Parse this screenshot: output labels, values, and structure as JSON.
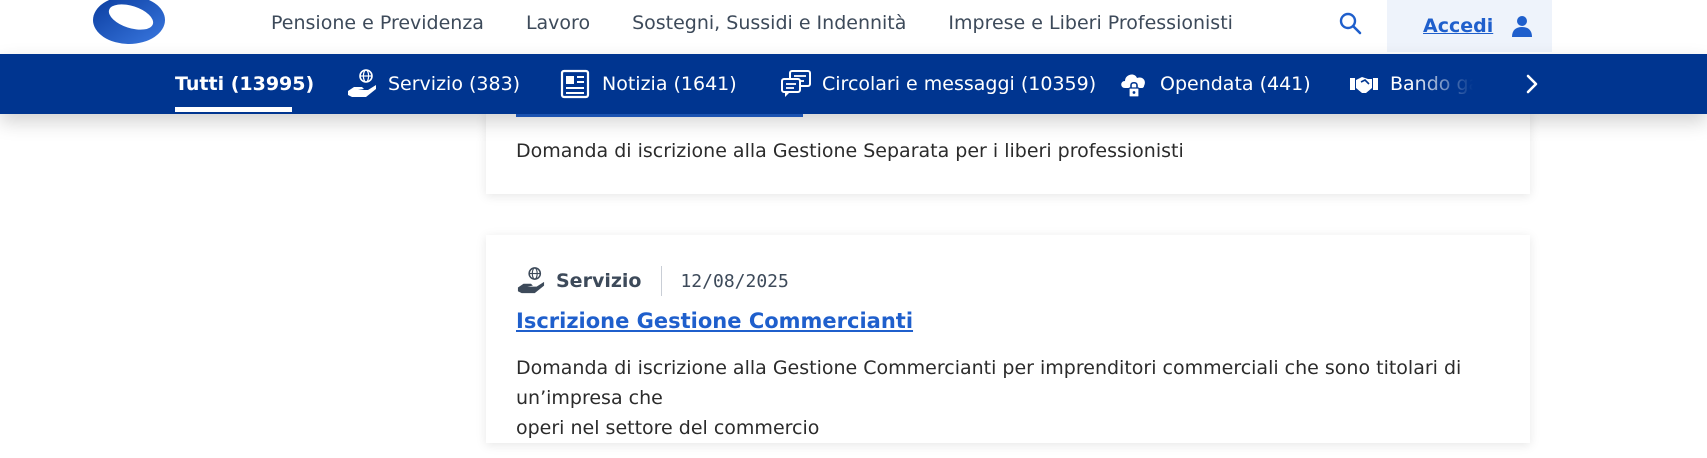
{
  "header": {
    "nav": [
      {
        "label": "Pensione e Previdenza"
      },
      {
        "label": "Lavoro"
      },
      {
        "label": "Sostegni, Sussidi e Indennità"
      },
      {
        "label": "Imprese e Liberi Professionisti"
      }
    ],
    "login_label": "Accedi"
  },
  "filters": {
    "tabs": [
      {
        "label": "Tutti (13995)",
        "active": true
      },
      {
        "label": "Servizio (383)",
        "icon": "hand-globe-icon"
      },
      {
        "label": "Notizia (1641)",
        "icon": "newspaper-icon"
      },
      {
        "label": "Circolari e messaggi (10359)",
        "icon": "messages-icon"
      },
      {
        "label": "Opendata (441)",
        "icon": "cloud-lock-icon"
      },
      {
        "label": "Bando gara",
        "icon": "handshake-icon"
      }
    ]
  },
  "results": [
    {
      "description": "Domanda di iscrizione alla Gestione Separata per i liberi professionisti"
    },
    {
      "type": "Servizio",
      "date": "12/08/2025",
      "title": "Iscrizione Gestione Commercianti",
      "description_line1": "Domanda di iscrizione alla Gestione Commercianti per imprenditori commerciali che sono titolari di un’impresa che",
      "description_line2": "operi nel settore del commercio"
    }
  ],
  "colors": {
    "primary_blue": "#003590",
    "link_blue": "#1f5fcc",
    "login_bg": "#eef3fb"
  }
}
